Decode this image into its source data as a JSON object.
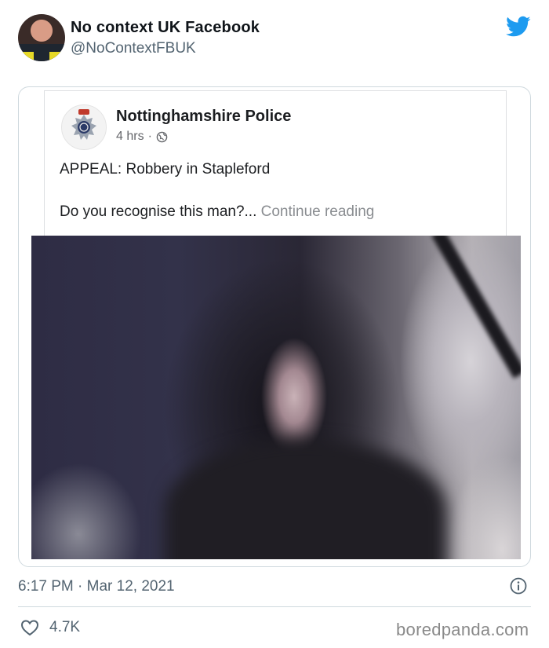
{
  "tweet": {
    "display_name": "No context UK Facebook",
    "handle": "@NoContextFBUK",
    "timestamp": "6:17 PM · Mar 12, 2021",
    "likes": "4.7K",
    "brand_color": "#1d9bf0"
  },
  "embedded_post": {
    "page_name": "Nottinghamshire Police",
    "time_ago": "4 hrs",
    "separator": "·",
    "line1": "APPEAL: Robbery in Stapleford",
    "line2": "Do you recognise this man?...",
    "continue_label": "Continue reading"
  },
  "watermark": "boredpanda.com"
}
